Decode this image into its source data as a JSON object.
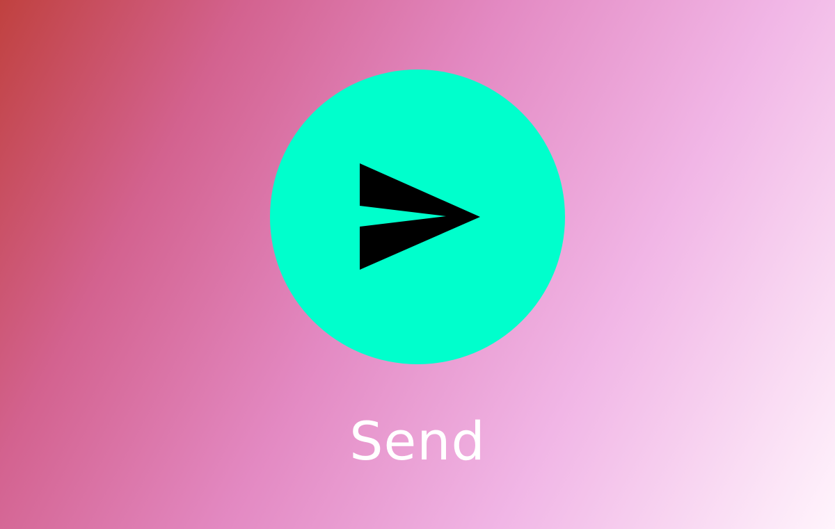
{
  "app": {
    "background_start": "#c0413f",
    "background_end": "#fff4fc"
  },
  "send_action": {
    "icon": "send-arrow-icon",
    "button_color": "#00ffcc",
    "icon_color": "#000000",
    "label": "Send",
    "label_color": "#ffffff"
  }
}
